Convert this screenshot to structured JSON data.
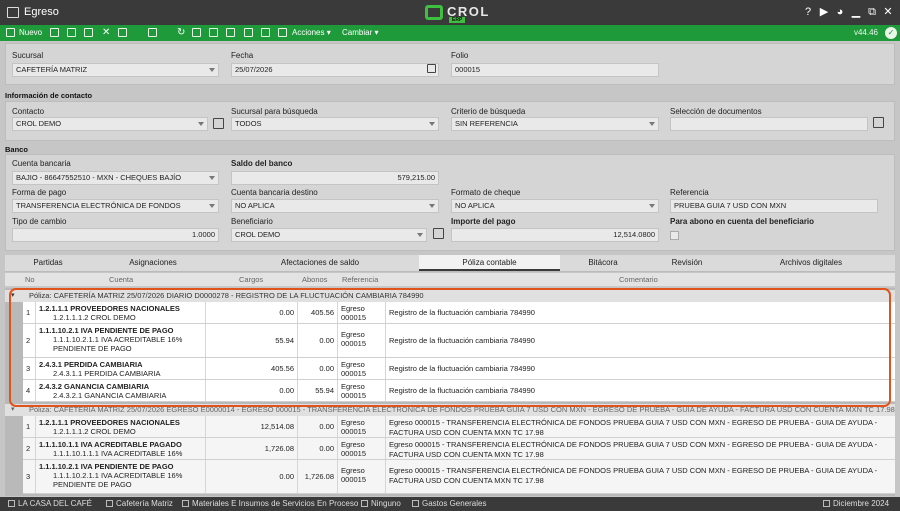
{
  "window": {
    "title": "Egreso",
    "logo": "CROL",
    "logo_sub": "ERP"
  },
  "toolbar": {
    "new_label": "Nuevo",
    "actions_label": "Acciones",
    "change_label": "Cambiar",
    "version": "v44.46"
  },
  "form": {
    "sucursal_label": "Sucursal",
    "sucursal_value": "CAFETERÍA MATRIZ",
    "fecha_label": "Fecha",
    "fecha_value": "25/07/2026",
    "folio_label": "Folio",
    "folio_value": "000015",
    "contact_section": "Información de contacto",
    "contacto_label": "Contacto",
    "contacto_value": "CROL DEMO",
    "sucursal_busqueda_label": "Sucursal para búsqueda",
    "sucursal_busqueda_value": "TODOS",
    "criterio_label": "Criterio de búsqueda",
    "criterio_value": "SIN REFERENCIA",
    "seleccion_label": "Selección de documentos",
    "seleccion_value": "",
    "bank_section": "Banco",
    "cuenta_label": "Cuenta bancaria",
    "cuenta_value": "BAJIO - 86647552510 - MXN - CHEQUES BAJÍO",
    "saldo_label": "Saldo del banco",
    "saldo_value": "579,215.00",
    "forma_pago_label": "Forma de pago",
    "forma_pago_value": "TRANSFERENCIA ELECTRÓNICA DE FONDOS",
    "cuenta_destino_label": "Cuenta bancaria destino",
    "cuenta_destino_value": "NO APLICA",
    "formato_label": "Formato de cheque",
    "formato_value": "NO APLICA",
    "referencia_label": "Referencia",
    "referencia_value": "PRUEBA GUIA 7 USD CON MXN",
    "tipo_cambio_label": "Tipo de cambio",
    "tipo_cambio_value": "1.0000",
    "beneficiario_label": "Beneficiario",
    "beneficiario_value": "CROL DEMO",
    "importe_label": "Importe del pago",
    "importe_value": "12,514.0800",
    "abono_label": "Para abono en cuenta del beneficiario"
  },
  "tabs": [
    "Partidas",
    "Asignaciones",
    "Afectaciones de saldo",
    "Póliza contable",
    "Bitácora",
    "Revisión",
    "Archivos digitales"
  ],
  "columns": [
    "No",
    "Cuenta",
    "Cargos",
    "Abonos",
    "Referencia",
    "Comentario"
  ],
  "poliza1": {
    "header": "Póliza: CAFETERÍA MATRIZ 25/07/2026 DIARIO D0000278 - REGISTRO DE LA FLUCTUACIÓN CAMBIARIA 784990",
    "rows": [
      {
        "no": "1",
        "acct": "1.2.1.1.1 PROVEEDORES NACIONALES",
        "sub": "1.2.1.1.1.2 CROL DEMO",
        "cargo": "0.00",
        "abono": "405.56",
        "ref1": "Egreso",
        "ref2": "000015",
        "comment": "Registro de la fluctuación cambiaria 784990"
      },
      {
        "no": "2",
        "acct": "1.1.1.10.2.1 IVA PENDIENTE DE PAGO",
        "sub": "1.1.1.10.2.1.1 IVA ACREDITABLE 16% PENDIENTE DE PAGO",
        "cargo": "55.94",
        "abono": "0.00",
        "ref1": "Egreso",
        "ref2": "000015",
        "comment": "Registro de la fluctuación cambiaria 784990"
      },
      {
        "no": "3",
        "acct": "2.4.3.1 PERDIDA CAMBIARIA",
        "sub": "2.4.3.1.1 PERDIDA CAMBIARIA",
        "cargo": "405.56",
        "abono": "0.00",
        "ref1": "Egreso",
        "ref2": "000015",
        "comment": "Registro de la fluctuación cambiaria 784990"
      },
      {
        "no": "4",
        "acct": "2.4.3.2 GANANCIA CAMBIARIA",
        "sub": "2.4.3.2.1 GANANCIA CAMBIARIA",
        "cargo": "0.00",
        "abono": "55.94",
        "ref1": "Egreso",
        "ref2": "000015",
        "comment": "Registro de la fluctuación cambiaria 784990"
      }
    ]
  },
  "poliza2": {
    "header": "Póliza: CAFETERÍA MATRIZ 25/07/2026 EGRESO E0000014 - EGRESO 000015 - TRANSFERENCIA ELECTRÓNICA DE FONDOS PRUEBA GUIA 7 USD CON MXN - EGRESO DE PRUEBA - GUIA DE AYUDA - FACTURA USD CON CUENTA MXN TC 17.98",
    "rows": [
      {
        "no": "1",
        "acct": "1.2.1.1.1 PROVEEDORES NACIONALES",
        "sub": "1.2.1.1.1.2 CROL DEMO",
        "cargo": "12,514.08",
        "abono": "0.00",
        "ref1": "Egreso",
        "ref2": "000015",
        "comment": "Egreso 000015 - TRANSFERENCIA ELECTRÓNICA DE FONDOS PRUEBA GUIA 7 USD CON MXN - EGRESO DE PRUEBA - GUIA DE AYUDA - FACTURA USD CON CUENTA MXN TC 17.98"
      },
      {
        "no": "2",
        "acct": "1.1.1.10.1.1 IVA ACREDITABLE PAGADO",
        "sub": "1.1.1.10.1.1.1 IVA ACREDITABLE 16% PAGADO",
        "cargo": "1,726.08",
        "abono": "0.00",
        "ref1": "Egreso",
        "ref2": "000015",
        "comment": "Egreso 000015 - TRANSFERENCIA ELECTRÓNICA DE FONDOS PRUEBA GUIA 7 USD CON MXN - EGRESO DE PRUEBA - GUIA DE AYUDA - FACTURA USD CON CUENTA MXN TC 17.98"
      },
      {
        "no": "3",
        "acct": "1.1.1.10.2.1 IVA PENDIENTE DE PAGO",
        "sub": "1.1.1.10.2.1.1 IVA ACREDITABLE 16% PENDIENTE DE PAGO",
        "cargo": "0.00",
        "abono": "1,726.08",
        "ref1": "Egreso",
        "ref2": "000015",
        "comment": "Egreso 000015 - TRANSFERENCIA ELECTRÓNICA DE FONDOS PRUEBA GUIA 7 USD CON MXN - EGRESO DE PRUEBA - GUIA DE AYUDA - FACTURA USD CON CUENTA MXN TC 17.98"
      }
    ]
  },
  "status": {
    "company": "LA CASA DEL CAFÉ",
    "branch": "Cafetería Matriz",
    "category": "Materiales E Insumos de Servicios En Proceso",
    "none": "Ninguno",
    "expenses": "Gastos Generales",
    "period": "Diciembre 2024"
  }
}
